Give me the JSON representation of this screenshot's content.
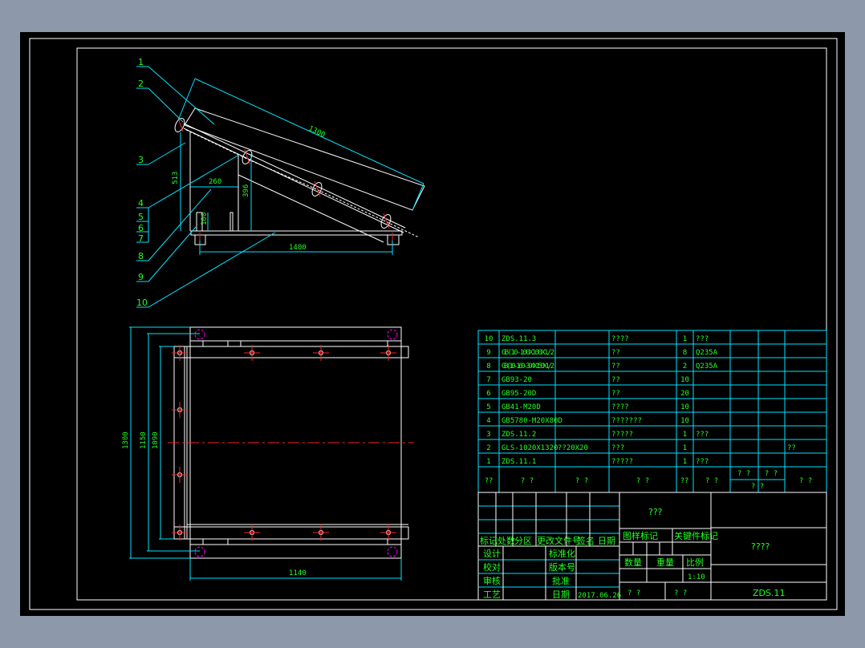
{
  "drawing": {
    "background": "#8d99ab",
    "callouts": [
      "1",
      "2",
      "3",
      "4",
      "5",
      "6",
      "7",
      "8",
      "9",
      "10"
    ],
    "side_view_dims": {
      "slant": "1300",
      "height": "513",
      "width": "260",
      "mid_height": "396",
      "foot": "100",
      "base": "1400"
    },
    "plan_view_dims": {
      "outer": "1300",
      "middle": "1150",
      "inner": "1090",
      "width": "1140"
    }
  },
  "parts_table": {
    "rows": [
      [
        "10",
        "ZDS.11.3",
        "",
        "????",
        "1",
        "???",
        "",
        "",
        ""
      ],
      [
        "9",
        "GB(10-100X100X1/2",
        "",
        "??",
        "8",
        "Q235A",
        "",
        "",
        ""
      ],
      [
        "8",
        "GB(10-160-394X150X1/2",
        "",
        "??",
        "2",
        "Q235A",
        "",
        "",
        ""
      ],
      [
        "7",
        "GB93-20",
        "",
        "??",
        "10",
        "",
        "",
        "",
        ""
      ],
      [
        "6",
        "GB95-20D",
        "",
        "??",
        "20",
        "",
        "",
        "",
        ""
      ],
      [
        "5",
        "GB41-M20D",
        "",
        "????",
        "10",
        "",
        "",
        "",
        ""
      ],
      [
        "4",
        "GB5780-M20X80D",
        "",
        "???????",
        "10",
        "",
        "",
        "",
        ""
      ],
      [
        "3",
        "ZDS.11.2",
        "",
        "?????",
        "1",
        "???",
        "",
        "",
        ""
      ],
      [
        "2",
        "GLS-1020X1320",
        "??20X20",
        "???",
        "1",
        "",
        "",
        "",
        "??"
      ],
      [
        "1",
        "ZDS.11.1",
        "",
        "?????",
        "1",
        "???",
        "",
        "",
        ""
      ]
    ],
    "header": [
      "??",
      "? ?",
      "? ?",
      "? ?",
      "??",
      "? ?",
      "? ?",
      "? ?",
      "? ?",
      "? ?"
    ]
  },
  "title_block": {
    "revision_header": [
      "标记",
      "处数",
      "分区",
      "更改文件号",
      "签名",
      "日期"
    ],
    "design": "设计",
    "check": "校对",
    "review": "审核",
    "process": "工艺",
    "standard": "标准化",
    "version": "版本号",
    "approve": "批准",
    "date_label": "日期",
    "date": "2017.06.26",
    "name": "???",
    "stage_mark": "图样标记",
    "key_mark": "关键件标记",
    "quantity": "数量",
    "weight": "重量",
    "scale": "比例",
    "scale_value": "1:10",
    "sheet": [
      "?  ?",
      "?  ?"
    ],
    "company": "????",
    "drawing_number": "ZDS.11"
  }
}
